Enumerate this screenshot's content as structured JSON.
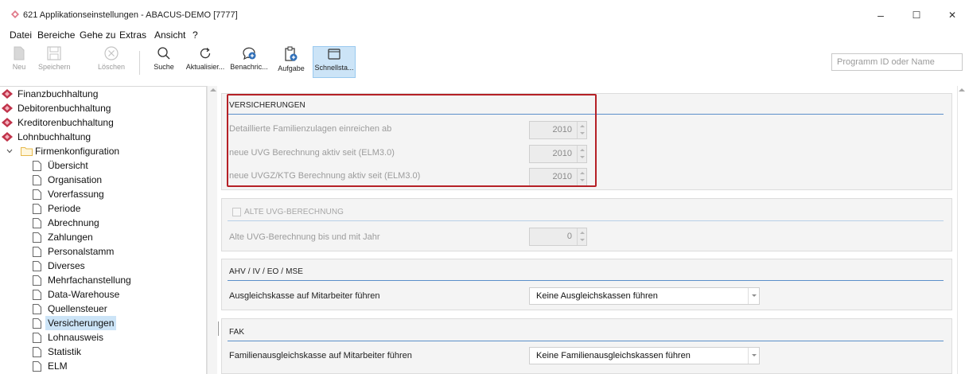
{
  "window": {
    "title": "621 Applikationseinstellungen - ABACUS-DEMO [7777]",
    "controls": {
      "minimize": "–",
      "maximize": "☐",
      "close": "✕"
    }
  },
  "menu": {
    "items": [
      {
        "label": "Datei"
      },
      {
        "label": "Bereiche"
      },
      {
        "label": "Gehe zu"
      },
      {
        "label": "Extras"
      },
      {
        "label": "Ansicht"
      },
      {
        "label": "?"
      }
    ]
  },
  "toolbar": {
    "buttons": [
      {
        "label": "Neu",
        "icon": "new-document-icon",
        "enabled": false
      },
      {
        "label": "Speichern",
        "icon": "save-icon",
        "enabled": false
      },
      {
        "label": "Löschen",
        "icon": "delete-icon",
        "enabled": false
      },
      {
        "label": "Suche",
        "icon": "search-icon",
        "enabled": true
      },
      {
        "label": "Aktualisier...",
        "icon": "refresh-icon",
        "enabled": true
      },
      {
        "label": "Benachric...",
        "icon": "notification-icon",
        "enabled": true
      },
      {
        "label": "Aufgabe",
        "icon": "task-icon",
        "enabled": true
      },
      {
        "label": "Schnellsta...",
        "icon": "quickstart-icon",
        "enabled": true,
        "active": true
      }
    ],
    "search_placeholder": "Programm ID oder Name"
  },
  "tree": {
    "top_items": [
      {
        "label": "Finanzbuchhaltung",
        "icon": "abacus-module-icon"
      },
      {
        "label": "Debitorenbuchhaltung",
        "icon": "abacus-module-icon"
      },
      {
        "label": "Kreditorenbuchhaltung",
        "icon": "abacus-module-icon"
      },
      {
        "label": "Lohnbuchhaltung",
        "icon": "abacus-module-icon"
      }
    ],
    "folder": {
      "label": "Firmenkonfiguration",
      "icon": "folder-icon",
      "expanded": true
    },
    "children": [
      {
        "label": "Übersicht"
      },
      {
        "label": "Organisation"
      },
      {
        "label": "Vorerfassung"
      },
      {
        "label": "Periode"
      },
      {
        "label": "Abrechnung"
      },
      {
        "label": "Zahlungen"
      },
      {
        "label": "Personalstamm"
      },
      {
        "label": "Diverses"
      },
      {
        "label": "Mehrfachanstellung"
      },
      {
        "label": "Data-Warehouse"
      },
      {
        "label": "Quellensteuer"
      },
      {
        "label": "Versicherungen",
        "selected": true
      },
      {
        "label": "Lohnausweis"
      },
      {
        "label": "Statistik"
      },
      {
        "label": "ELM"
      }
    ]
  },
  "sections": {
    "versicherungen": {
      "title": "VERSICHERUNGEN",
      "fields": [
        {
          "label": "Detaillierte Familienzulagen einreichen ab",
          "value": "2010"
        },
        {
          "label": "neue UVG Berechnung aktiv seit (ELM3.0)",
          "value": "2010"
        },
        {
          "label": "neue UVGZ/KTG Berechnung aktiv seit (ELM3.0)",
          "value": "2010"
        }
      ]
    },
    "alte_uvg": {
      "title": "ALTE UVG-BERECHNUNG",
      "checked": false,
      "fields": [
        {
          "label": "Alte UVG-Berechnung bis und mit Jahr",
          "value": "0"
        }
      ]
    },
    "ahv": {
      "title": "AHV / IV / EO / MSE",
      "field_label": "Ausgleichskasse auf Mitarbeiter führen",
      "selected": "Keine Ausgleichskassen führen"
    },
    "fak": {
      "title": "FAK",
      "field_label": "Familienausgleichskasse auf Mitarbeiter führen",
      "selected": "Keine Familienausgleichskassen führen"
    }
  },
  "colors": {
    "accent_line": "#5b8fc9",
    "highlight_border": "#b52026",
    "selection": "#cce4f7",
    "module_icon": "#c0334a"
  }
}
